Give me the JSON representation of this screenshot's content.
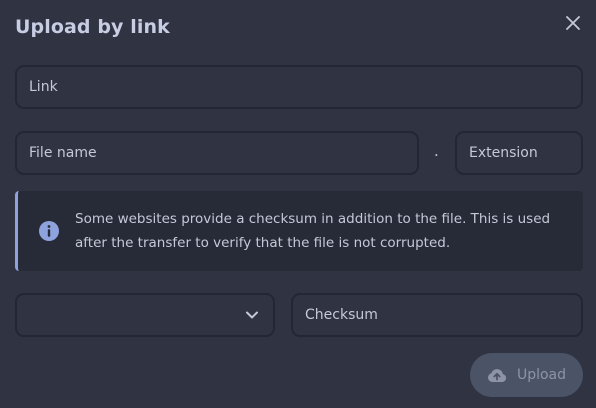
{
  "dialog": {
    "title": "Upload by link"
  },
  "fields": {
    "link_placeholder": "Link",
    "file_name_placeholder": "File name",
    "separator": ".",
    "extension_placeholder": "Extension",
    "checksum_type_value": "",
    "checksum_placeholder": "Checksum"
  },
  "info": {
    "text": "Some websites provide a checksum in addition to the file. This is used after the transfer to verify that the file is not corrupted."
  },
  "actions": {
    "upload_label": "Upload"
  },
  "icons": {
    "close": "close-icon",
    "info": "info-circle-icon",
    "dropdown": "chevron-down-icon",
    "upload": "cloud-upload-icon"
  },
  "colors": {
    "background": "#2f3342",
    "field_border": "#232634",
    "info_background": "#272b37",
    "info_accent": "#8ea2dd",
    "button_background": "#4b5366"
  }
}
